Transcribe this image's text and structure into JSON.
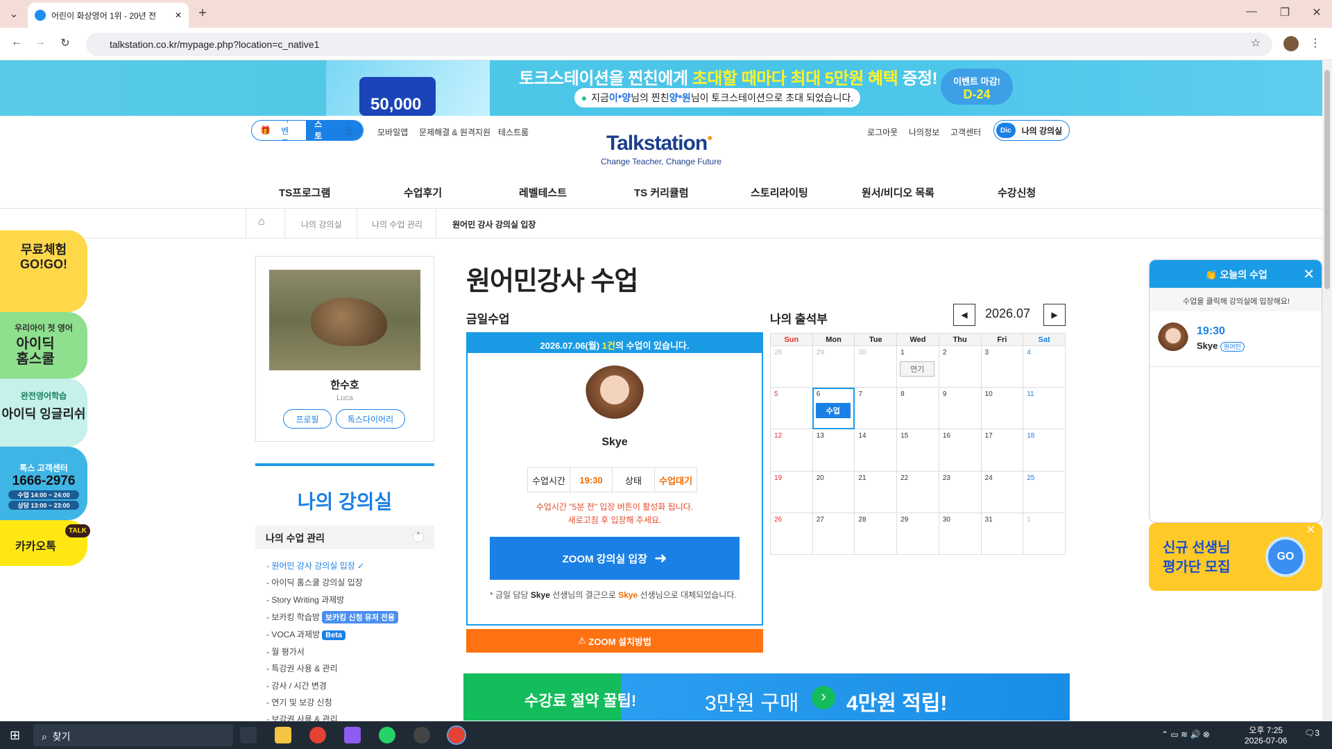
{
  "browser": {
    "tab_title": "어린이 화상영어 1위 - 20년 전",
    "url": "talkstation.co.kr/mypage.php?location=c_native1"
  },
  "banner": {
    "headline_pre": "토크스테이션을 찐친에게 ",
    "headline_highlight": "초대할 때마다 최대 5만원 혜택",
    "headline_post": " 증정!",
    "sub_pre": "지금 ",
    "sub_name1": "이*양",
    "sub_mid": " 님의 찐친 ",
    "sub_name2": "양*원",
    "sub_post": " 님이 토크스테이션으로 초대 되었습니다.",
    "coupon_amount": "50,000",
    "event_label": "이벤트 마감!",
    "dday": "D-24"
  },
  "header": {
    "event_btn": "이벤트",
    "story_btn": "TS스토리",
    "links_left": [
      "모바일앱",
      "문제해결 & 원격지원",
      "테스트룸"
    ],
    "logo": "Talkstation",
    "logo_sub": "Change Teacher, Change Future",
    "links_right": [
      "로그아웃",
      "나의정보",
      "고객센터"
    ],
    "dic": "Dic",
    "my_class_btn": "나의 강의실"
  },
  "nav": [
    "TS프로그램",
    "수업후기",
    "레벨테스트",
    "TS 커리큘럼",
    "스토리라이팅",
    "원서/비디오 목록",
    "수강신청"
  ],
  "breadcrumb": [
    "나의 강의실",
    "나의 수업 관리",
    "원어민 강사 강의실 입장"
  ],
  "left_banners": {
    "free_trial": "무료체험\nGO!GO!",
    "idic_home_small": "우리아이 첫 영어",
    "idic_home": "아이딕\n홈스쿨",
    "idic_eng_small": "완전영어학습",
    "idic_eng": "아이딕 잉글리쉬",
    "cs_label": "톡스 고객센터",
    "cs_phone": "1666-2976",
    "cs_hours1": "수업 14:00 ~ 24:00",
    "cs_hours2": "상담 13:00 ~ 23:00",
    "kakao": "카카오톡",
    "kakao_talk": "TALK"
  },
  "profile": {
    "name": "한수호",
    "eng_name": "Luca",
    "btn_profile": "프로필",
    "btn_diary": "톡스다이어리"
  },
  "sidebar": {
    "title": "나의 강의실",
    "section": "나의 수업 관리",
    "items": [
      {
        "label": "- 원어민 강사 강의실 입장",
        "active": true
      },
      {
        "label": "- 아이딕 홈스쿨 강의실 입장"
      },
      {
        "label": "- Story Writing 과제방"
      },
      {
        "label": "- 보카킹 학습방",
        "badge": "보카킹 신청 유저 전용"
      },
      {
        "label": "- VOCA 과제방",
        "badge": "Beta"
      },
      {
        "label": "- 월 평가서"
      },
      {
        "label": "- 특강권 사용 & 관리"
      },
      {
        "label": "- 강사 / 시간 변경"
      },
      {
        "label": "- 연기 및 보강 신청"
      },
      {
        "label": "- 보강권 사용 & 관리"
      }
    ]
  },
  "main": {
    "title": "원어민강사 수업",
    "today_label": "금일수업",
    "today_head_pre": "2026.07.06(월) ",
    "today_head_count": "1건",
    "today_head_post": "의 수업이 있습니다.",
    "teacher": "Skye",
    "time_label": "수업시간",
    "time_value": "19:30",
    "status_label": "상태",
    "status_value": "수업대기",
    "warn1": "수업시간 \"5분 전\" 입장 버튼이 활성화 됩니다.",
    "warn2": "새로고침 후 입장해 주세요.",
    "zoom_btn": "ZOOM 강의실 입장",
    "note_pre": "* 금일 담당 ",
    "note_teacher1": "Skye",
    "note_mid": " 선생님의 결근으로 ",
    "note_teacher2": "Skye",
    "note_post": " 선생님으로 대체되었습니다.",
    "install_btn": "ZOOM 설치방법"
  },
  "calendar": {
    "title": "나의 출석부",
    "month": "2026.07",
    "weekdays": [
      "Sun",
      "Mon",
      "Tue",
      "Wed",
      "Thu",
      "Fri",
      "Sat"
    ],
    "weeks": [
      [
        "28",
        "29",
        "30",
        "1",
        "2",
        "3",
        "4"
      ],
      [
        "5",
        "6",
        "7",
        "8",
        "9",
        "10",
        "11"
      ],
      [
        "12",
        "13",
        "14",
        "15",
        "16",
        "17",
        "18"
      ],
      [
        "19",
        "20",
        "21",
        "22",
        "23",
        "24",
        "25"
      ],
      [
        "26",
        "27",
        "28",
        "29",
        "30",
        "31",
        "1"
      ]
    ],
    "event_postpone": "연기",
    "event_class": "수업"
  },
  "popup": {
    "title": "오늘의 수업",
    "subtitle": "수업을 클릭해 강의실에 입장해요!",
    "time": "19:30",
    "teacher": "Skye",
    "tag": "원어민"
  },
  "recruit": {
    "line1": "신규 선생님",
    "line2": "평가단 모집",
    "go": "GO"
  },
  "bottom_banner": {
    "left": "수강료 절약 꿀팁!",
    "mid": "3만원 구매",
    "right": "4만원 적립!"
  },
  "taskbar": {
    "search": "찾기",
    "time": "오후 7:25",
    "date": "2026-07-06",
    "notif": "3"
  }
}
